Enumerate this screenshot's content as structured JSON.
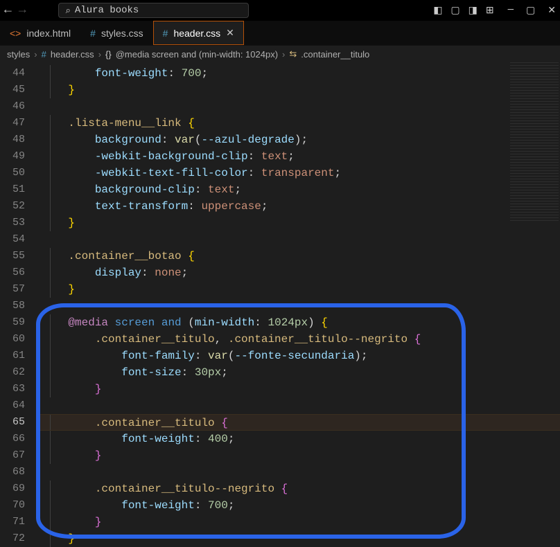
{
  "titlebar": {
    "search_text": "Alura books"
  },
  "tabs": [
    {
      "icon": "html-file-icon",
      "label": "index.html",
      "active": false
    },
    {
      "icon": "css-file-icon",
      "label": "styles.css",
      "active": false
    },
    {
      "icon": "css-file-icon",
      "label": "header.css",
      "active": true
    }
  ],
  "breadcrumbs": {
    "segment1": "styles",
    "segment2": "header.css",
    "segment3": "@media screen and (min-width: 1024px)",
    "segment4": ".container__titulo"
  },
  "line_numbers": [
    "44",
    "45",
    "46",
    "47",
    "48",
    "49",
    "50",
    "51",
    "52",
    "53",
    "54",
    "55",
    "56",
    "57",
    "58",
    "59",
    "60",
    "61",
    "62",
    "63",
    "64",
    "65",
    "66",
    "67",
    "68",
    "69",
    "70",
    "71",
    "72"
  ],
  "highlight_line": "65",
  "code_lines": [
    {
      "indent": 2,
      "tokens": [
        {
          "t": "font-weight",
          "c": "tok-c"
        },
        {
          "t": ": ",
          "c": "tok-p"
        },
        {
          "t": "700",
          "c": "tok-n"
        },
        {
          "t": ";",
          "c": "tok-p"
        }
      ]
    },
    {
      "indent": 1,
      "tokens": [
        {
          "t": "}",
          "c": "tok-br"
        }
      ]
    },
    {
      "indent": 0,
      "tokens": []
    },
    {
      "indent": 1,
      "tokens": [
        {
          "t": ".lista-menu__link",
          "c": "tok-sel"
        },
        {
          "t": " {",
          "c": "tok-br"
        }
      ]
    },
    {
      "indent": 2,
      "tokens": [
        {
          "t": "background",
          "c": "tok-c"
        },
        {
          "t": ": ",
          "c": "tok-p"
        },
        {
          "t": "var",
          "c": "tok-y"
        },
        {
          "t": "(",
          "c": "tok-p"
        },
        {
          "t": "--azul-degrade",
          "c": "tok-c"
        },
        {
          "t": ")",
          "c": "tok-p"
        },
        {
          "t": ";",
          "c": "tok-p"
        }
      ]
    },
    {
      "indent": 2,
      "tokens": [
        {
          "t": "-webkit-background-clip",
          "c": "tok-c"
        },
        {
          "t": ": ",
          "c": "tok-p"
        },
        {
          "t": "text",
          "c": "tok-o"
        },
        {
          "t": ";",
          "c": "tok-p"
        }
      ]
    },
    {
      "indent": 2,
      "tokens": [
        {
          "t": "-webkit-text-fill-color",
          "c": "tok-c"
        },
        {
          "t": ": ",
          "c": "tok-p"
        },
        {
          "t": "transparent",
          "c": "tok-o"
        },
        {
          "t": ";",
          "c": "tok-p"
        }
      ]
    },
    {
      "indent": 2,
      "tokens": [
        {
          "t": "background-clip",
          "c": "tok-c"
        },
        {
          "t": ": ",
          "c": "tok-p"
        },
        {
          "t": "text",
          "c": "tok-o"
        },
        {
          "t": ";",
          "c": "tok-p"
        }
      ]
    },
    {
      "indent": 2,
      "tokens": [
        {
          "t": "text-transform",
          "c": "tok-c"
        },
        {
          "t": ": ",
          "c": "tok-p"
        },
        {
          "t": "uppercase",
          "c": "tok-o"
        },
        {
          "t": ";",
          "c": "tok-p"
        }
      ]
    },
    {
      "indent": 1,
      "tokens": [
        {
          "t": "}",
          "c": "tok-br"
        }
      ]
    },
    {
      "indent": 0,
      "tokens": []
    },
    {
      "indent": 1,
      "tokens": [
        {
          "t": ".container__botao",
          "c": "tok-sel"
        },
        {
          "t": " {",
          "c": "tok-br"
        }
      ]
    },
    {
      "indent": 2,
      "tokens": [
        {
          "t": "display",
          "c": "tok-c"
        },
        {
          "t": ": ",
          "c": "tok-p"
        },
        {
          "t": "none",
          "c": "tok-o"
        },
        {
          "t": ";",
          "c": "tok-p"
        }
      ]
    },
    {
      "indent": 1,
      "tokens": [
        {
          "t": "}",
          "c": "tok-br"
        }
      ]
    },
    {
      "indent": 0,
      "tokens": []
    },
    {
      "indent": 1,
      "tokens": [
        {
          "t": "@media",
          "c": "tok-k"
        },
        {
          "t": " ",
          "c": "tok-p"
        },
        {
          "t": "screen",
          "c": "tok-kw"
        },
        {
          "t": " ",
          "c": "tok-p"
        },
        {
          "t": "and",
          "c": "tok-kw"
        },
        {
          "t": " (",
          "c": "tok-p"
        },
        {
          "t": "min-width",
          "c": "tok-c"
        },
        {
          "t": ": ",
          "c": "tok-p"
        },
        {
          "t": "1024px",
          "c": "tok-n"
        },
        {
          "t": ") ",
          "c": "tok-p"
        },
        {
          "t": "{",
          "c": "tok-br"
        }
      ]
    },
    {
      "indent": 2,
      "tokens": [
        {
          "t": ".container__titulo",
          "c": "tok-sel"
        },
        {
          "t": ", ",
          "c": "tok-p"
        },
        {
          "t": ".container__titulo--negrito",
          "c": "tok-sel"
        },
        {
          "t": " {",
          "c": "tok-br2"
        }
      ]
    },
    {
      "indent": 3,
      "tokens": [
        {
          "t": "font-family",
          "c": "tok-c"
        },
        {
          "t": ": ",
          "c": "tok-p"
        },
        {
          "t": "var",
          "c": "tok-y"
        },
        {
          "t": "(",
          "c": "tok-p"
        },
        {
          "t": "--fonte-secundaria",
          "c": "tok-c"
        },
        {
          "t": ")",
          "c": "tok-p"
        },
        {
          "t": ";",
          "c": "tok-p"
        }
      ]
    },
    {
      "indent": 3,
      "tokens": [
        {
          "t": "font-size",
          "c": "tok-c"
        },
        {
          "t": ": ",
          "c": "tok-p"
        },
        {
          "t": "30px",
          "c": "tok-n"
        },
        {
          "t": ";",
          "c": "tok-p"
        }
      ]
    },
    {
      "indent": 2,
      "tokens": [
        {
          "t": "}",
          "c": "tok-br2"
        }
      ]
    },
    {
      "indent": 0,
      "tokens": []
    },
    {
      "indent": 2,
      "tokens": [
        {
          "t": ".container__titulo",
          "c": "tok-sel"
        },
        {
          "t": " {",
          "c": "tok-br2"
        }
      ]
    },
    {
      "indent": 3,
      "tokens": [
        {
          "t": "font-weight",
          "c": "tok-c"
        },
        {
          "t": ": ",
          "c": "tok-p"
        },
        {
          "t": "400",
          "c": "tok-n"
        },
        {
          "t": ";",
          "c": "tok-p"
        }
      ]
    },
    {
      "indent": 2,
      "tokens": [
        {
          "t": "}",
          "c": "tok-br2"
        }
      ]
    },
    {
      "indent": 0,
      "tokens": []
    },
    {
      "indent": 2,
      "tokens": [
        {
          "t": ".container__titulo--negrito",
          "c": "tok-sel"
        },
        {
          "t": " {",
          "c": "tok-br2"
        }
      ]
    },
    {
      "indent": 3,
      "tokens": [
        {
          "t": "font-weight",
          "c": "tok-c"
        },
        {
          "t": ": ",
          "c": "tok-p"
        },
        {
          "t": "700",
          "c": "tok-n"
        },
        {
          "t": ";",
          "c": "tok-p"
        }
      ]
    },
    {
      "indent": 2,
      "tokens": [
        {
          "t": "}",
          "c": "tok-br2"
        }
      ]
    },
    {
      "indent": 1,
      "tokens": [
        {
          "t": "}",
          "c": "tok-br"
        }
      ]
    }
  ]
}
